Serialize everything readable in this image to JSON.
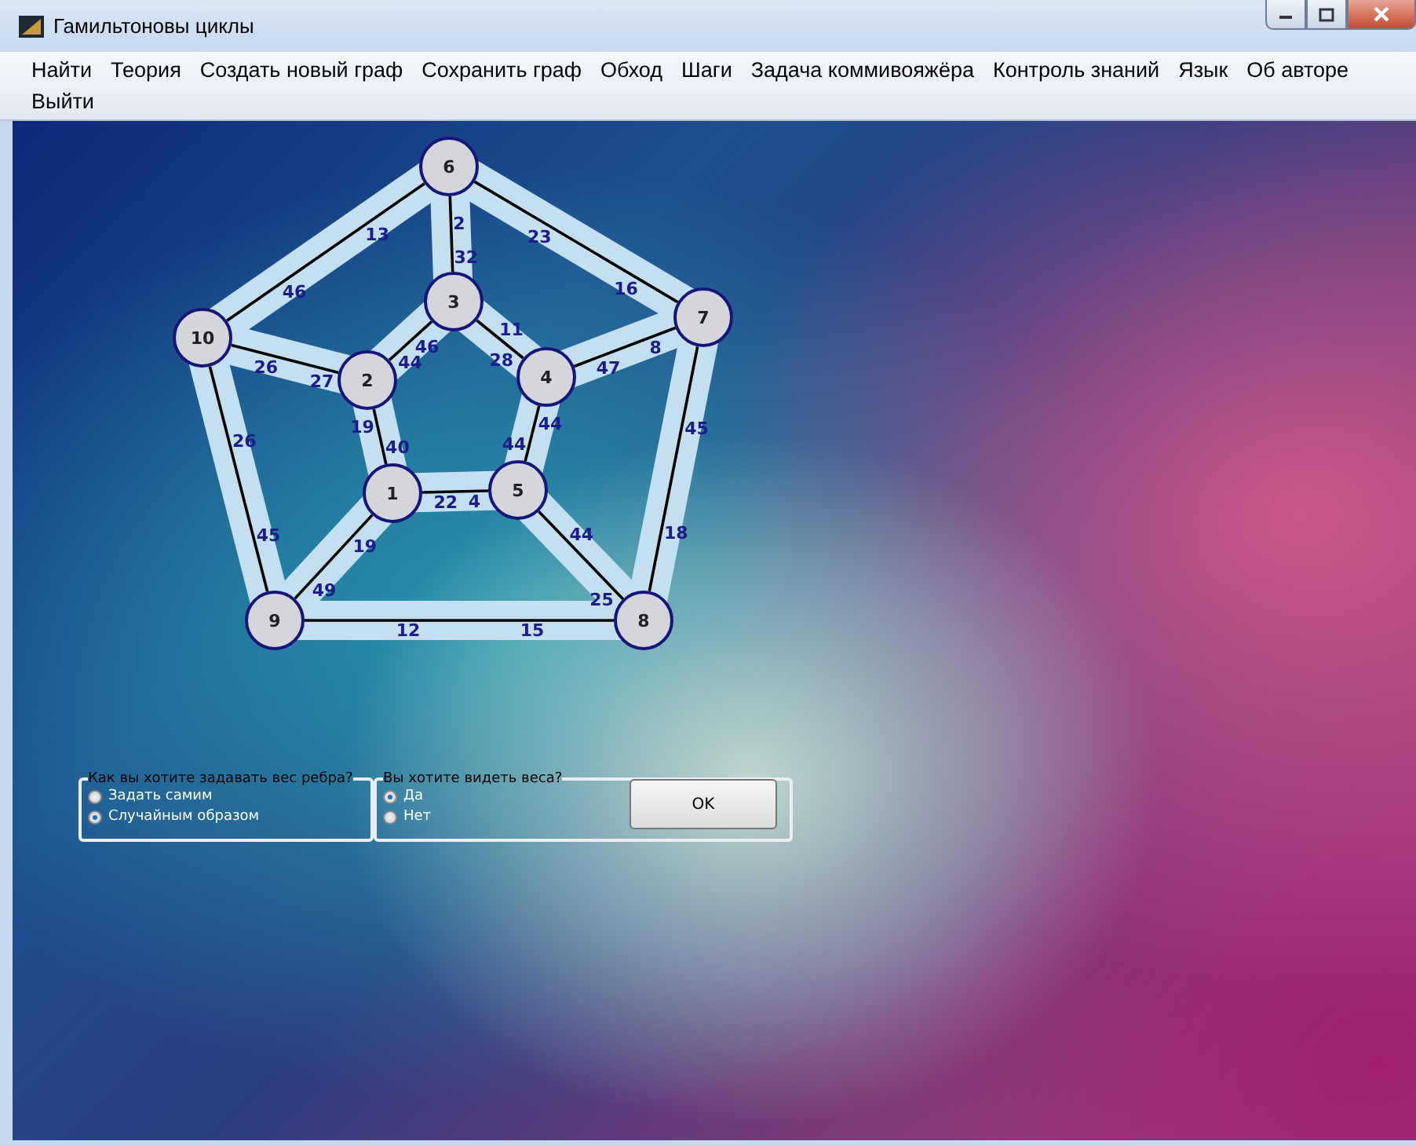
{
  "window": {
    "title": "Гамильтоновы циклы"
  },
  "menu": [
    "Найти",
    "Теория",
    "Создать новый граф",
    "Сохранить граф",
    "Обход",
    "Шаги",
    "Задача коммивояжёра",
    "Контроль знаний",
    "Язык",
    "Об авторе",
    "Выйти"
  ],
  "graph": {
    "nodes": [
      "6",
      "3",
      "7",
      "10",
      "2",
      "4",
      "1",
      "5",
      "9",
      "8"
    ],
    "edges": [
      {
        "weights": [
          "13",
          "46"
        ]
      },
      {
        "weights": [
          "2",
          "32"
        ]
      },
      {
        "weights": [
          "23",
          "16"
        ]
      },
      {
        "weights": [
          "26",
          "27"
        ]
      },
      {
        "weights": [
          "46",
          "44"
        ]
      },
      {
        "weights": [
          "11",
          "28"
        ]
      },
      {
        "weights": [
          "47",
          "8"
        ]
      },
      {
        "weights": [
          "19",
          "40"
        ]
      },
      {
        "weights": [
          "44",
          "44"
        ]
      },
      {
        "weights": [
          "22",
          "4"
        ]
      },
      {
        "weights": [
          "26",
          "45"
        ]
      },
      {
        "weights": [
          "45",
          "18"
        ]
      },
      {
        "weights": [
          "19",
          "49"
        ]
      },
      {
        "weights": [
          "44",
          "25"
        ]
      },
      {
        "weights": [
          "12",
          "15"
        ]
      }
    ]
  },
  "options": {
    "groups": [
      {
        "title": "Как вы хотите задавать вес ребра?",
        "options": [
          {
            "label": "Задать самим",
            "selected": false
          },
          {
            "label": "Случайным образом",
            "selected": true
          }
        ]
      },
      {
        "title": "Вы хотите видеть веса?",
        "options": [
          {
            "label": "Да",
            "selected": true
          },
          {
            "label": "Нет",
            "selected": false
          }
        ]
      }
    ],
    "button": "OK"
  }
}
